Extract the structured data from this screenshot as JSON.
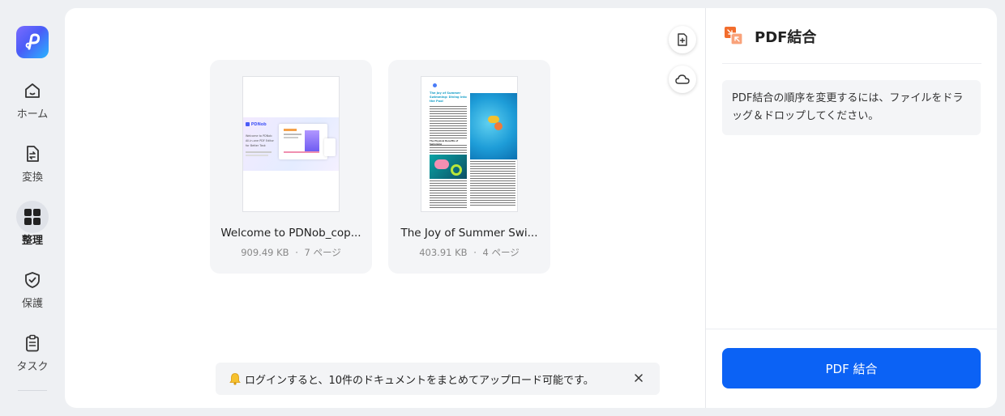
{
  "sidebar": {
    "items": [
      {
        "label": "ホーム",
        "icon": "home-icon"
      },
      {
        "label": "変換",
        "icon": "convert-icon"
      },
      {
        "label": "整理",
        "icon": "organize-icon",
        "active": true
      },
      {
        "label": "保護",
        "icon": "shield-icon"
      },
      {
        "label": "タスク",
        "icon": "clipboard-icon"
      }
    ]
  },
  "files": [
    {
      "name": "Welcome to PDNob_cop...",
      "size": "909.49 KB",
      "pages": "7 ページ",
      "thumb": {
        "brand": "PDNob",
        "lines": [
          "Welcome to PDNob",
          "All-in-one PDF Editor",
          "for Better Task"
        ]
      }
    },
    {
      "name": "The Joy of Summer Swi...",
      "size": "403.91 KB",
      "pages": "4 ページ",
      "thumb": {
        "heading": [
          "The Joy of Summer",
          "Swimming: Diving into",
          "the Pool"
        ],
        "subhead": "The Physical Benefits of Swimming"
      }
    }
  ],
  "meta_separator": "·",
  "notice": {
    "text": "ログインすると、10件のドキュメントをまとめてアップロード可能です。"
  },
  "panel": {
    "title": "PDF結合",
    "help": "PDF結合の順序を変更するには、ファイルをドラッグ＆ドロップしてください。",
    "merge_button": "PDF 結合"
  },
  "colors": {
    "accent": "#0b62f5",
    "title_icon": "#f26d2d"
  }
}
